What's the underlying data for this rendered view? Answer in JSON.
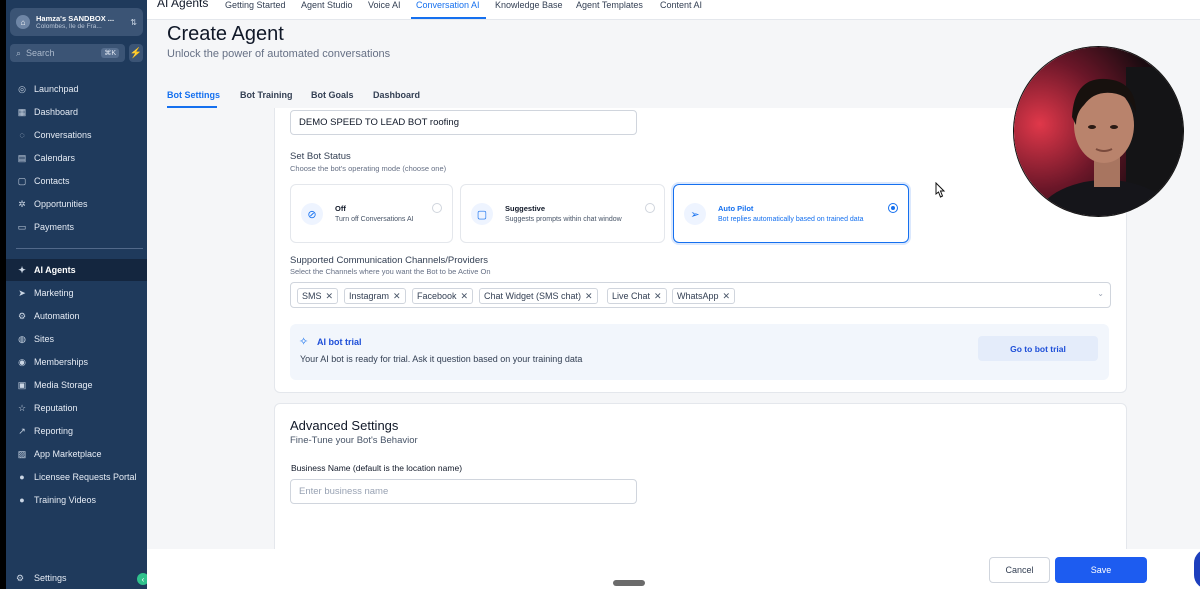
{
  "sidebar": {
    "account": {
      "name": "Hamza's SANDBOX ...",
      "location": "Colombes, Ile de Fra..."
    },
    "search": {
      "label": "Search",
      "shortcut": "⌘K"
    },
    "items": [
      {
        "label": "Launchpad",
        "icon": "rocket-icon",
        "glyph": "◎"
      },
      {
        "label": "Dashboard",
        "icon": "grid-icon",
        "glyph": "▦"
      },
      {
        "label": "Conversations",
        "icon": "chat-icon",
        "glyph": "◌"
      },
      {
        "label": "Calendars",
        "icon": "calendar-icon",
        "glyph": "▤"
      },
      {
        "label": "Contacts",
        "icon": "contacts-icon",
        "glyph": "▢"
      },
      {
        "label": "Opportunities",
        "icon": "funnel-icon",
        "glyph": "✲"
      },
      {
        "label": "Payments",
        "icon": "card-icon",
        "glyph": "▭"
      }
    ],
    "items2": [
      {
        "label": "AI Agents",
        "icon": "sparkle-icon",
        "glyph": "✦"
      },
      {
        "label": "Marketing",
        "icon": "send-icon",
        "glyph": "➤"
      },
      {
        "label": "Automation",
        "icon": "automation-icon",
        "glyph": "⚙"
      },
      {
        "label": "Sites",
        "icon": "globe-icon",
        "glyph": "◍"
      },
      {
        "label": "Memberships",
        "icon": "membership-icon",
        "glyph": "◉"
      },
      {
        "label": "Media Storage",
        "icon": "media-icon",
        "glyph": "▣"
      },
      {
        "label": "Reputation",
        "icon": "star-icon",
        "glyph": "☆"
      },
      {
        "label": "Reporting",
        "icon": "chart-icon",
        "glyph": "↗"
      },
      {
        "label": "App Marketplace",
        "icon": "marketplace-icon",
        "glyph": "▨"
      },
      {
        "label": "Licensee Requests Portal",
        "icon": "portal-icon",
        "glyph": "●"
      },
      {
        "label": "Training Videos",
        "icon": "video-icon",
        "glyph": "●"
      }
    ],
    "settings": "Settings"
  },
  "topnav": {
    "title": "AI Agents",
    "items": [
      "Getting Started",
      "Agent Studio",
      "Voice AI",
      "Conversation AI",
      "Knowledge Base",
      "Agent Templates",
      "Content AI"
    ]
  },
  "page": {
    "title": "Create Agent",
    "subtitle": "Unlock the power of automated conversations",
    "tabs": [
      "Bot Settings",
      "Bot Training",
      "Bot Goals",
      "Dashboard"
    ]
  },
  "bot": {
    "name_value": "DEMO SPEED TO LEAD BOT roofing",
    "status_label": "Set Bot Status",
    "status_sub": "Choose the bot's operating mode (choose one)",
    "modes": [
      {
        "title": "Off",
        "desc": "Turn off Conversations AI",
        "icon": "bot-off-icon",
        "glyph": "⊘"
      },
      {
        "title": "Suggestive",
        "desc": "Suggests prompts within chat window",
        "icon": "chat-bubble-icon",
        "glyph": "▢"
      },
      {
        "title": "Auto Pilot",
        "desc": "Bot replies automatically based on trained data",
        "icon": "paper-plane-icon",
        "glyph": "➢"
      }
    ],
    "selected_mode": "Auto Pilot",
    "channels_label": "Supported Communication Channels/Providers",
    "channels_sub": "Select the Channels where you want the Bot to be Active On",
    "channels": [
      "SMS",
      "Instagram",
      "Facebook",
      "Chat Widget (SMS chat)",
      "Live Chat",
      "WhatsApp"
    ]
  },
  "trial": {
    "title": "AI bot trial",
    "desc": "Your AI bot is ready for trial. Ask it question based on your training data",
    "button": "Go to bot trial"
  },
  "advanced": {
    "title": "Advanced Settings",
    "subtitle": "Fine-Tune your Bot's Behavior",
    "business_label": "Business Name (default is the location name)",
    "business_placeholder": "Enter business name"
  },
  "footer": {
    "cancel": "Cancel",
    "save": "Save"
  },
  "colors": {
    "accent": "#1570ef",
    "sidebar": "#1f3a5c",
    "save": "#1d5cf0",
    "trial_bg": "#f2f6fc"
  }
}
